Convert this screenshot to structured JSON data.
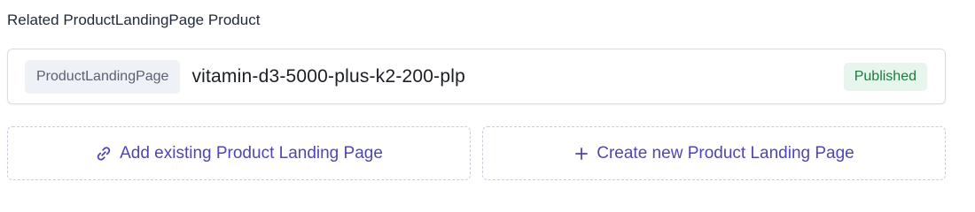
{
  "section": {
    "title": "Related ProductLandingPage Product"
  },
  "reference": {
    "content_type": "ProductLandingPage",
    "entry_title": "vitamin-d3-5000-plus-k2-200-plp",
    "status": "Published"
  },
  "actions": {
    "add_existing_label": "Add existing Product Landing Page",
    "add_existing_icon": "link-icon",
    "create_new_label": "Create new Product Landing Page",
    "create_new_icon": "plus-icon"
  },
  "colors": {
    "accent": "#4f46b5",
    "status_published_bg": "#e7f6ec",
    "status_published_text": "#1d7a3e",
    "chip_bg": "#eef1f6"
  }
}
